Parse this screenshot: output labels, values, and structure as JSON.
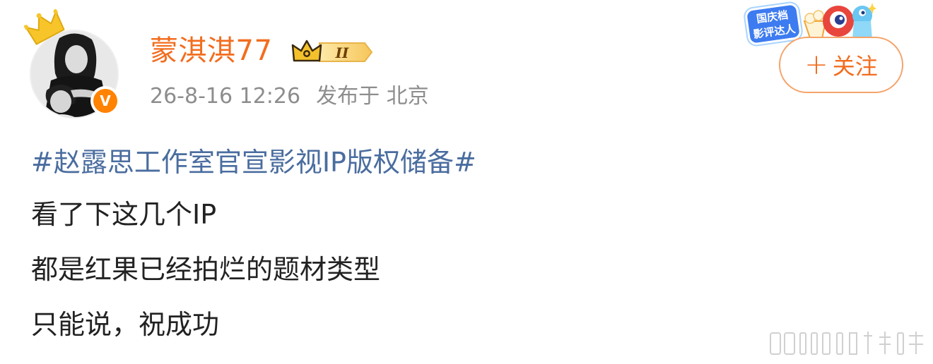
{
  "post": {
    "author": {
      "name": "蒙淇淇77",
      "level_badge_text": "II",
      "verified_badge_text": "V"
    },
    "meta": {
      "time": "26-8-16 12:26",
      "location": "发布于 北京"
    },
    "follow_button": {
      "plus": "+",
      "label": "关注"
    },
    "event_sticker": {
      "line1": "国庆档",
      "line2": "影评达人"
    },
    "content": {
      "hashtag": "#赵露思工作室官宣影视IP版权储备#",
      "lines": [
        "看了下这几个IP",
        "都是红果已经拍烂的题材类型",
        "只能说，祝成功"
      ]
    }
  },
  "colors": {
    "username": "#f26d1f",
    "follow_border": "#f5a36a",
    "hashtag": "#4a6d9f",
    "meta": "#8d8d8d",
    "body_text": "#222222",
    "verified": "#ff8200",
    "crown": "#f5c518"
  },
  "icons": {
    "avatar_crown": "crown-icon",
    "level": "crown-level-badge-icon",
    "verified": "verified-v-icon",
    "sticker_mascot": "mascot-icon",
    "watermark": "weibo-watermark"
  }
}
